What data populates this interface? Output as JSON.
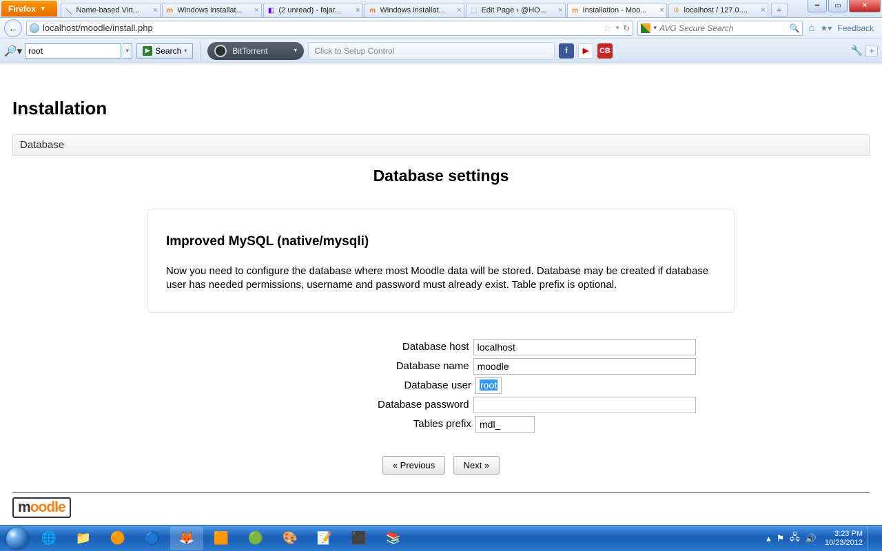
{
  "firefox_button": "Firefox",
  "tabs": [
    {
      "label": "Name-based Virt...",
      "icon": "🔖"
    },
    {
      "label": "Windows installat...",
      "icon": "m"
    },
    {
      "label": "(2 unread) - fajar...",
      "icon": "◧"
    },
    {
      "label": "Windows installat...",
      "icon": "m"
    },
    {
      "label": "Edit Page ‹ @HO...",
      "icon": "⬚"
    },
    {
      "label": "Installation - Moo...",
      "icon": "m",
      "active": true
    },
    {
      "label": "localhost / 127.0....",
      "icon": "⚙"
    }
  ],
  "url": "localhost/moodle/install.php",
  "avg_search_placeholder": "AVG Secure Search",
  "feedback_label": "Feedback",
  "toolbar": {
    "search_value": "root",
    "search_button": "Search",
    "bittorrent": "BitTorrent",
    "setup_control": "Click to Setup Control"
  },
  "page": {
    "title": "Installation",
    "section": "Database",
    "heading": "Database settings",
    "driver_title": "Improved MySQL (native/mysqli)",
    "driver_desc": "Now you need to configure the database where most Moodle data will be stored. Database may be created if database user has needed permissions, username and password must already exist. Table prefix is optional.",
    "labels": {
      "host": "Database host",
      "name": "Database name",
      "user": "Database user",
      "pass": "Database password",
      "prefix": "Tables prefix"
    },
    "values": {
      "host": "localhost",
      "name": "moodle",
      "user": "root",
      "pass": "",
      "prefix": "mdl_"
    },
    "prev_button": "« Previous",
    "next_button": "Next »",
    "logo": {
      "pre": "m",
      "rest": "oodle"
    }
  },
  "tray": {
    "time": "3:23 PM",
    "date": "10/23/2012"
  }
}
